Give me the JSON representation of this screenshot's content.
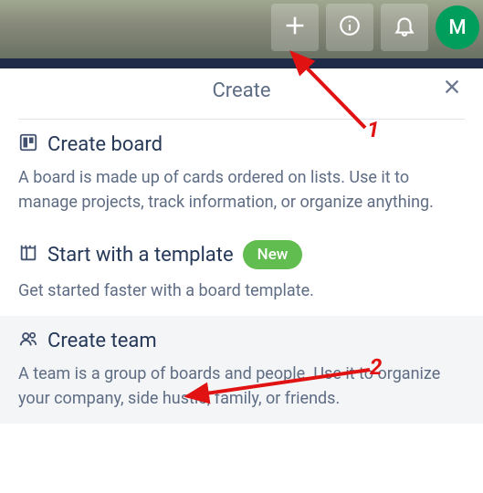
{
  "header": {
    "avatar_initial": "M"
  },
  "popover": {
    "title": "Create"
  },
  "items": [
    {
      "title": "Create board",
      "desc": "A board is made up of cards ordered on lists. Use it to manage projects, track information, or organize anything."
    },
    {
      "title": "Start with a template",
      "badge": "New",
      "desc": "Get started faster with a board template."
    },
    {
      "title": "Create team",
      "desc": "A team is a group of boards and people. Use it to organize your company, side hustle, family, or friends."
    }
  ],
  "annotations": {
    "label1": "1",
    "label2": "2"
  }
}
